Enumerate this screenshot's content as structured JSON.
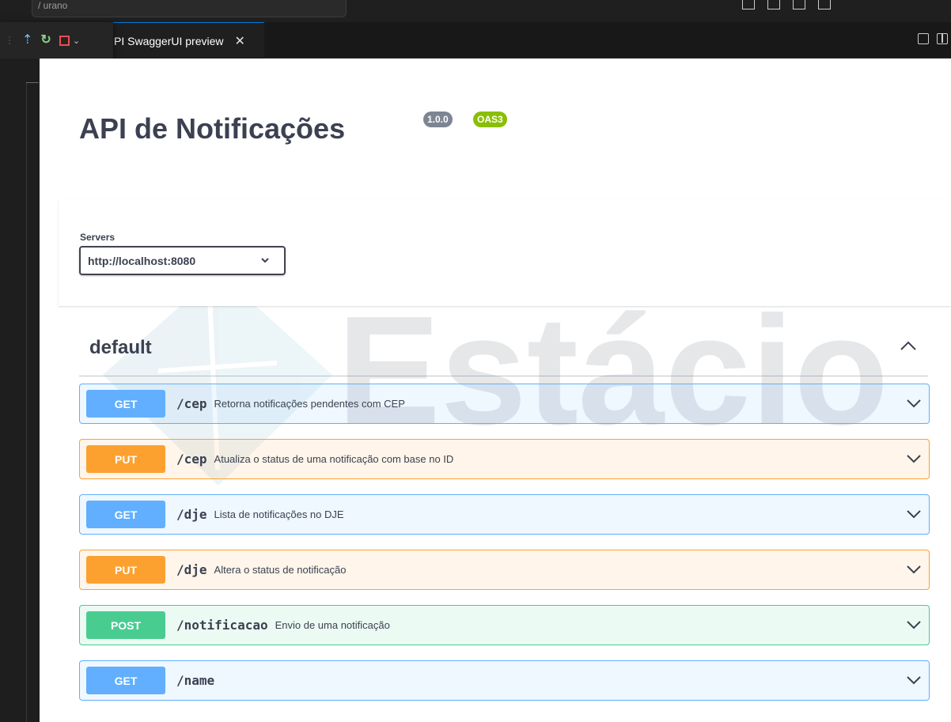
{
  "editor": {
    "command_center_text": "/ urano",
    "tab_title": "PI SwaggerUI preview",
    "tab_close": "✕"
  },
  "swagger": {
    "title": "API de Notificações",
    "version_badge": "1.0.0",
    "oas_badge": "OAS3",
    "servers": {
      "label": "Servers",
      "selected": "http://localhost:8080"
    },
    "tag": {
      "name": "default"
    },
    "operations": [
      {
        "method": "GET",
        "path": "/cep",
        "summary": "Retorna notificações pendentes com CEP"
      },
      {
        "method": "PUT",
        "path": "/cep",
        "summary": "Atualiza o status de uma notificação com base no ID"
      },
      {
        "method": "GET",
        "path": "/dje",
        "summary": "Lista de notificações no DJE"
      },
      {
        "method": "PUT",
        "path": "/dje",
        "summary": "Altera o status de notificação"
      },
      {
        "method": "POST",
        "path": "/notificacao",
        "summary": "Envio de uma notificação"
      },
      {
        "method": "GET",
        "path": "/name",
        "summary": ""
      }
    ]
  },
  "watermark": {
    "text": "Estácio"
  },
  "colors": {
    "get": "#61affe",
    "put": "#fca130",
    "post": "#49cc90",
    "text": "#3b4151",
    "oas_badge": "#89bf04",
    "version_badge": "#7d8492"
  }
}
